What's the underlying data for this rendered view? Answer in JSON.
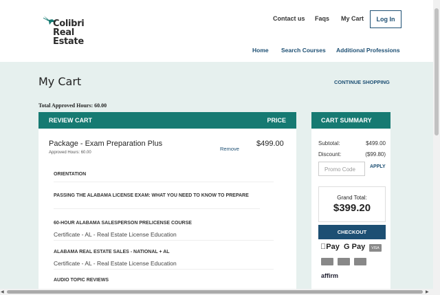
{
  "header": {
    "logo_line1": "Colibri",
    "logo_line2": "Real Estate",
    "topnav": [
      "Contact us",
      "Faqs",
      "My Cart"
    ],
    "login_label": "Log In",
    "mainnav": [
      "Home",
      "Search Courses",
      "Additional Professions"
    ]
  },
  "page": {
    "title": "My Cart",
    "continue_label": "CONTINUE SHOPPING",
    "total_hours": "Total Approved Hours: 60.00"
  },
  "review": {
    "heading": "REVIEW CART",
    "price_heading": "PRICE",
    "package": {
      "name": "Package - Exam Preparation Plus",
      "hours": "Approved Hours: 60.00",
      "remove_label": "Remove",
      "price": "$499.00"
    },
    "courses": [
      {
        "title": "ORIENTATION",
        "sub": ""
      },
      {
        "title": "PASSING THE ALABAMA LICENSE EXAM: WHAT YOU NEED TO KNOW TO PREPARE",
        "sub": ""
      },
      {
        "title": "60-HOUR ALABAMA SALESPERSON PRELICENSE COURSE",
        "sub": "Certificate - AL - Real Estate License Education"
      },
      {
        "title": "ALABAMA REAL ESTATE SALES - NATIONAL + AL",
        "sub": "Certificate - AL - Real Estate License Education"
      },
      {
        "title": "AUDIO TOPIC REVIEWS",
        "sub": ""
      }
    ]
  },
  "summary": {
    "heading": "CART SUMMARY",
    "subtotal_label": "Subtotal:",
    "subtotal": "$499.00",
    "discount_label": "Discount:",
    "discount": "($99.80)",
    "promo_placeholder": "Promo Code",
    "apply_label": "APPLY",
    "grand_label": "Grand Total:",
    "grand_value": "$399.20",
    "checkout_label": "CHECKOUT",
    "apple_pay": "Pay",
    "google_pay": "G Pay",
    "visa": "VISA",
    "affirm": "affirm"
  },
  "colors": {
    "teal": "#167a72",
    "navy": "#1d4f73",
    "background": "#e6f0ee"
  }
}
